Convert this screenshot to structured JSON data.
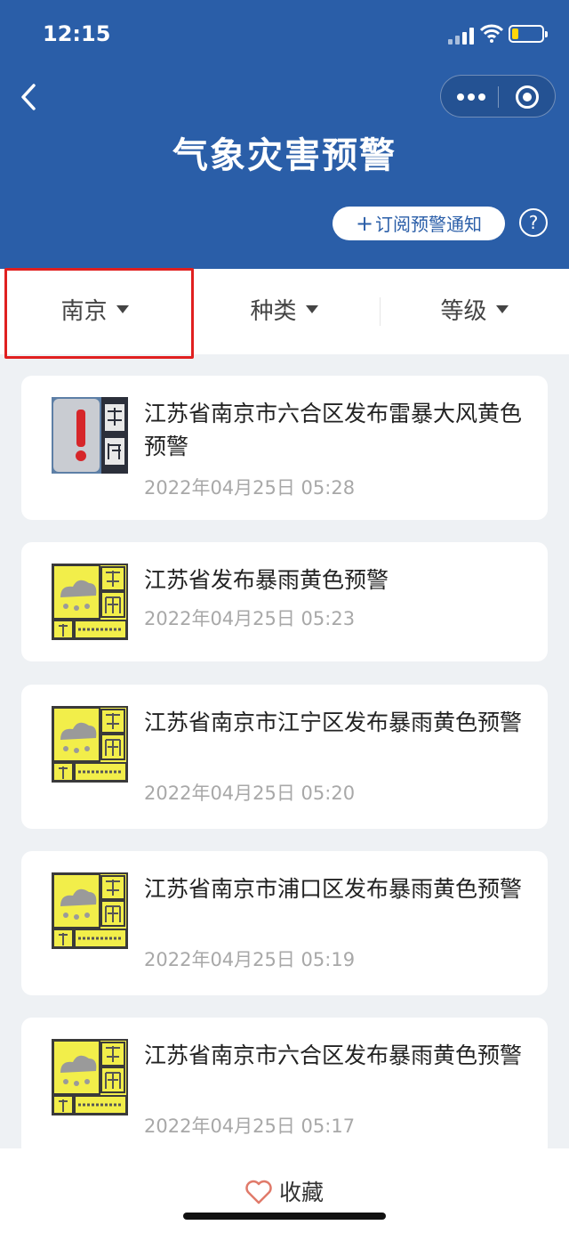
{
  "status_bar": {
    "time": "12:15"
  },
  "header": {
    "title": "气象灾害预警",
    "subscribe_label": "订阅预警通知",
    "subscribe_plus": "+",
    "help_label": "?"
  },
  "filters": {
    "city": "南京",
    "type": "种类",
    "level": "等级"
  },
  "alerts": [
    {
      "icon": "thunderstorm-wind-warning-icon",
      "title": "江苏省南京市六合区发布雷暴大风黄色预警",
      "time": "2022年04月25日 05:28"
    },
    {
      "icon": "rainstorm-yellow-icon",
      "title": "江苏省发布暴雨黄色预警",
      "time": "2022年04月25日 05:23"
    },
    {
      "icon": "rainstorm-yellow-icon",
      "title": "江苏省南京市江宁区发布暴雨黄色预警",
      "time": "2022年04月25日 05:20"
    },
    {
      "icon": "rainstorm-yellow-icon",
      "title": "江苏省南京市浦口区发布暴雨黄色预警",
      "time": "2022年04月25日 05:19"
    },
    {
      "icon": "rainstorm-yellow-icon",
      "title": "江苏省南京市六合区发布暴雨黄色预警",
      "time": "2022年04月25日 05:17"
    }
  ],
  "bottom": {
    "favorite_label": "收藏"
  },
  "colors": {
    "header_bg": "#2a5ea8",
    "highlight": "#e02020",
    "warning_yellow": "#f2ee4a"
  }
}
